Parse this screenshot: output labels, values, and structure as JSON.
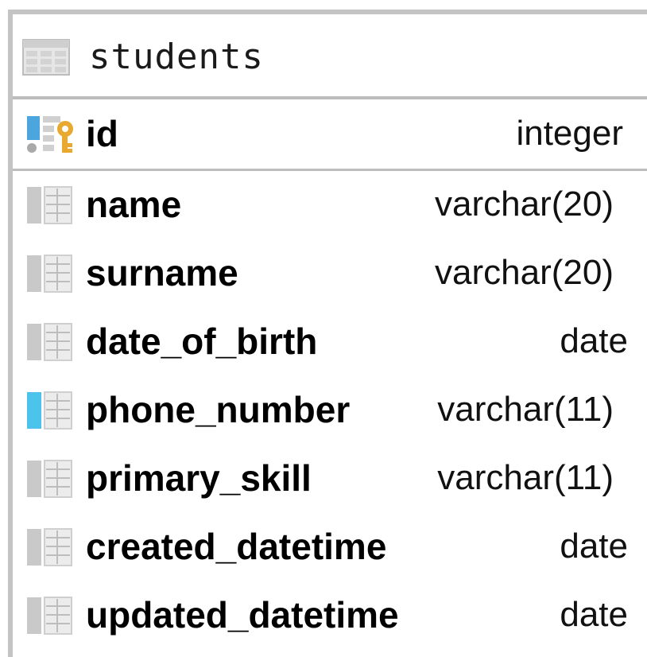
{
  "table": {
    "name": "students",
    "icon": "table-icon"
  },
  "primary_key": {
    "name": "id",
    "type": "integer",
    "icon": "primary-key-column-icon"
  },
  "columns": [
    {
      "name": "name",
      "type": "varchar(20)",
      "icon": "column-icon",
      "accent": "#c9c9c9"
    },
    {
      "name": "surname",
      "type": "varchar(20)",
      "icon": "column-icon",
      "accent": "#c9c9c9"
    },
    {
      "name": "date_of_birth",
      "type": "date",
      "icon": "column-icon",
      "accent": "#c9c9c9"
    },
    {
      "name": "phone_number",
      "type": "varchar(11)",
      "icon": "column-icon",
      "accent": "#4cc3ea"
    },
    {
      "name": "primary_skill",
      "type": "varchar(11)",
      "icon": "column-icon",
      "accent": "#c9c9c9"
    },
    {
      "name": "created_datetime",
      "type": "date",
      "icon": "column-icon",
      "accent": "#c9c9c9"
    },
    {
      "name": "updated_datetime",
      "type": "date",
      "icon": "column-icon",
      "accent": "#c9c9c9"
    }
  ],
  "colors": {
    "border": "#c4c4c4",
    "key": "#e8a92e",
    "pk_bar": "#4aa6dc"
  }
}
